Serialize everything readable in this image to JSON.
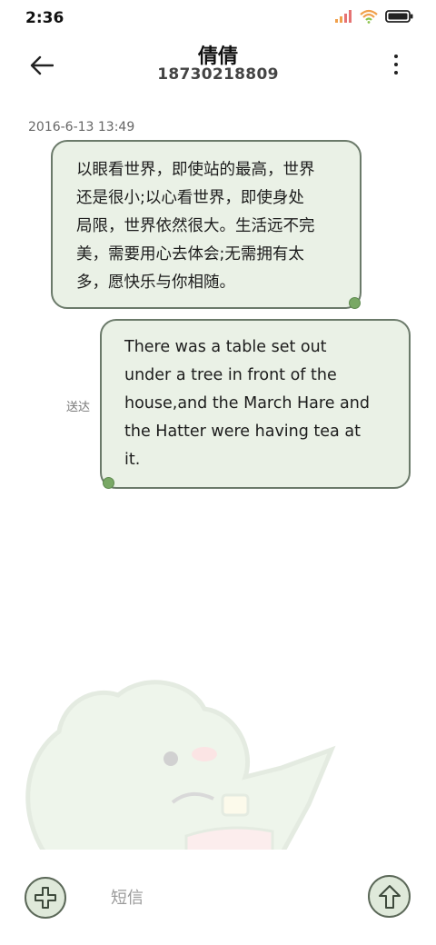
{
  "status_bar": {
    "time": "2:36",
    "icons": [
      "signal-icon",
      "wifi-icon",
      "battery-icon"
    ]
  },
  "header": {
    "contact_name": "倩倩",
    "phone_number": "18730218809",
    "back_icon": "back-arrow-icon",
    "more_icon": "more-vertical-icon"
  },
  "conversation": {
    "timestamp": "2016-6-13 13:49",
    "messages": [
      {
        "direction": "incoming",
        "lines": [
          "以眼看世界，即使站的最高，世界",
          "还是很小;以心看世界，即使身处",
          "局限，世界依然很大。生活远不完",
          "美，需要用心去体会;无需拥有太",
          "多，愿快乐与你相随。"
        ]
      },
      {
        "direction": "outgoing",
        "status": "送达",
        "lines": [
          "There was a table set out",
          "under a tree in front of the",
          "house,and the March Hare and",
          "the Hatter were having tea at",
          "it."
        ]
      }
    ]
  },
  "composer": {
    "placeholder": "短信",
    "add_icon": "plus-circle-icon",
    "send_icon": "send-arrow-up-icon"
  },
  "colors": {
    "bubble_fill": "#eaf1e6",
    "bubble_border": "#6b7a6a",
    "accent_green": "#79a865"
  }
}
